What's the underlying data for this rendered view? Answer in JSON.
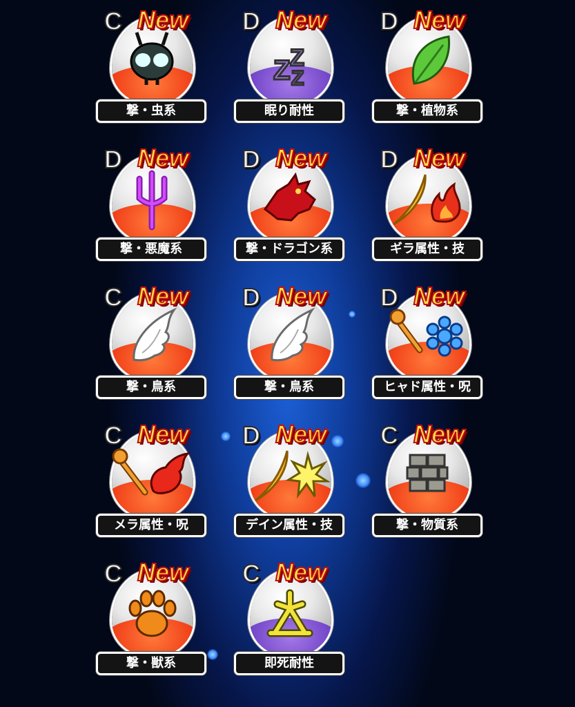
{
  "items": [
    {
      "rank": "C",
      "badge": "New",
      "label": "撃・虫系",
      "icon": "bug-icon",
      "egg": "red"
    },
    {
      "rank": "D",
      "badge": "New",
      "label": "眠り耐性",
      "icon": "sleep-zzz-icon",
      "egg": "purple"
    },
    {
      "rank": "D",
      "badge": "New",
      "label": "撃・植物系",
      "icon": "leaf-icon",
      "egg": "red"
    },
    {
      "rank": "D",
      "badge": "New",
      "label": "撃・悪魔系",
      "icon": "trident-icon",
      "egg": "red"
    },
    {
      "rank": "D",
      "badge": "New",
      "label": "撃・ドラゴン系",
      "icon": "dragon-icon",
      "egg": "red"
    },
    {
      "rank": "D",
      "badge": "New",
      "label": "ギラ属性・技",
      "icon": "slash-fire-icon",
      "egg": "red"
    },
    {
      "rank": "C",
      "badge": "New",
      "label": "撃・鳥系",
      "icon": "wing-icon",
      "egg": "red"
    },
    {
      "rank": "D",
      "badge": "New",
      "label": "撃・鳥系",
      "icon": "wing-icon",
      "egg": "red"
    },
    {
      "rank": "D",
      "badge": "New",
      "label": "ヒャド属性・呪",
      "icon": "staff-ice-icon",
      "egg": "red"
    },
    {
      "rank": "C",
      "badge": "New",
      "label": "メラ属性・呪",
      "icon": "staff-fireball-icon",
      "egg": "red"
    },
    {
      "rank": "D",
      "badge": "New",
      "label": "デイン属性・技",
      "icon": "slash-lightning-icon",
      "egg": "red"
    },
    {
      "rank": "C",
      "badge": "New",
      "label": "撃・物質系",
      "icon": "bricks-icon",
      "egg": "red"
    },
    {
      "rank": "C",
      "badge": "New",
      "label": "撃・獣系",
      "icon": "paw-icon",
      "egg": "red"
    },
    {
      "rank": "C",
      "badge": "New",
      "label": "即死耐性",
      "icon": "death-resist-icon",
      "egg": "purple"
    }
  ]
}
